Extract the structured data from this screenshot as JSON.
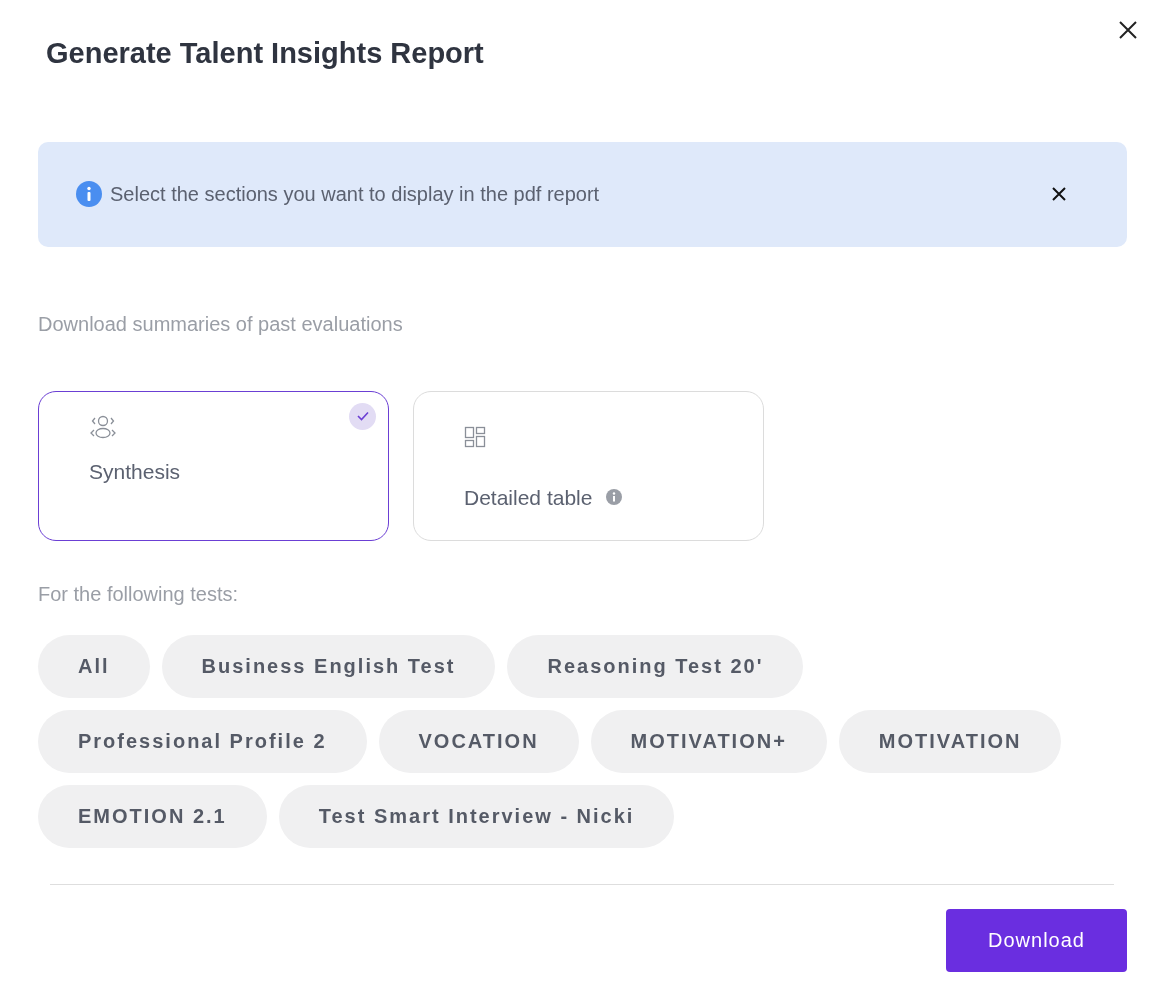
{
  "dialog": {
    "title": "Generate Talent Insights Report"
  },
  "banner": {
    "text": "Select the sections you want to display in the pdf report"
  },
  "sections_label": "Download summaries of past evaluations",
  "options": [
    {
      "kind": "synthesis",
      "label": "Synthesis",
      "selected": true,
      "info": false
    },
    {
      "kind": "table",
      "label": "Detailed table",
      "selected": false,
      "info": true
    }
  ],
  "tests_label": "For the following tests:",
  "tests": [
    {
      "label": "All"
    },
    {
      "label": "Business English Test"
    },
    {
      "label": "Reasoning Test 20'"
    },
    {
      "label": "Professional Profile 2"
    },
    {
      "label": "VOCATION"
    },
    {
      "label": "MOTIVATION+"
    },
    {
      "label": "MOTIVATION"
    },
    {
      "label": "EMOTION 2.1"
    },
    {
      "label": "Test Smart Interview - Nicki"
    }
  ],
  "download_button": "Download"
}
